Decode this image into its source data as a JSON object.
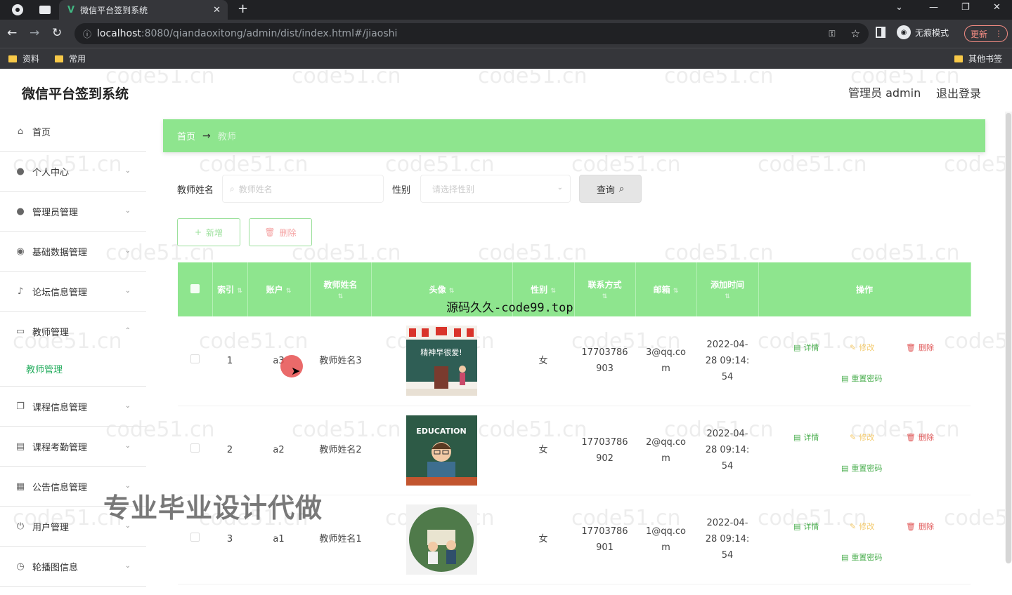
{
  "browser": {
    "tab_title": "微信平台签到系统",
    "tab_logo": "V",
    "url_host": "localhost",
    "url_path": ":8080/qiandaoxitong/admin/dist/index.html#/jiaoshi",
    "incognito_label": "无痕模式",
    "update_label": "更新",
    "bookmarks": [
      "资料",
      "常用"
    ],
    "other_bookmarks": "其他书签"
  },
  "header": {
    "brand": "微信平台签到系统",
    "user": "管理员 admin",
    "logout": "退出登录"
  },
  "sidebar": {
    "items": [
      {
        "label": "首页",
        "icon": "home-icon"
      },
      {
        "label": "个人中心",
        "icon": "user-icon"
      },
      {
        "label": "管理员管理",
        "icon": "user-icon"
      },
      {
        "label": "基础数据管理",
        "icon": "location-icon"
      },
      {
        "label": "论坛信息管理",
        "icon": "mic-icon"
      },
      {
        "label": "教师管理",
        "icon": "message-icon"
      },
      {
        "label": "课程信息管理",
        "icon": "copy-icon"
      },
      {
        "label": "课程考勤管理",
        "icon": "document-icon"
      },
      {
        "label": "公告信息管理",
        "icon": "grid-icon"
      },
      {
        "label": "用户管理",
        "icon": "power-icon"
      },
      {
        "label": "轮播图信息",
        "icon": "clock-icon"
      }
    ],
    "active_sub": "教师管理"
  },
  "breadcrumb": {
    "home": "首页",
    "current": "教师"
  },
  "search": {
    "name_label": "教师姓名",
    "name_placeholder": "教师姓名",
    "gender_label": "性别",
    "gender_placeholder": "请选择性别",
    "query_label": "查询"
  },
  "actions": {
    "add": "新增",
    "delete": "删除"
  },
  "table": {
    "headers": [
      "索引",
      "账户",
      "教师姓名",
      "头像",
      "性别",
      "联系方式",
      "邮箱",
      "添加时间",
      "操作"
    ],
    "rows": [
      {
        "index": "1",
        "account": "a3",
        "name": "教师姓名3",
        "gender": "女",
        "phone": [
          "17703786",
          "903"
        ],
        "email": [
          "3@qq.co",
          "m"
        ],
        "time": [
          "2022-04-",
          "28 09:14:",
          "54"
        ],
        "avatar": "classroom"
      },
      {
        "index": "2",
        "account": "a2",
        "name": "教师姓名2",
        "gender": "女",
        "phone": [
          "17703786",
          "902"
        ],
        "email": [
          "2@qq.co",
          "m"
        ],
        "time": [
          "2022-04-",
          "28 09:14:",
          "54"
        ],
        "avatar": "education"
      },
      {
        "index": "3",
        "account": "a1",
        "name": "教师姓名1",
        "gender": "女",
        "phone": [
          "17703786",
          "901"
        ],
        "email": [
          "1@qq.co",
          "m"
        ],
        "time": [
          "2022-04-",
          "28 09:14:",
          "54"
        ],
        "avatar": "circle"
      }
    ],
    "ops": {
      "detail": "详情",
      "edit": "修改",
      "delete": "删除",
      "reset": "重置密码"
    }
  },
  "avatar_texts": {
    "board": "精神早很爱!",
    "education": "EDUCATION"
  },
  "overlays": {
    "top": "源码久久-code99.top",
    "big": "专业毕业设计代做",
    "watermark": "code51.cn"
  },
  "colors": {
    "accent": "#8ee58e",
    "link_green": "#4caf50",
    "danger": "#e05555",
    "warning": "#f3c96b"
  }
}
